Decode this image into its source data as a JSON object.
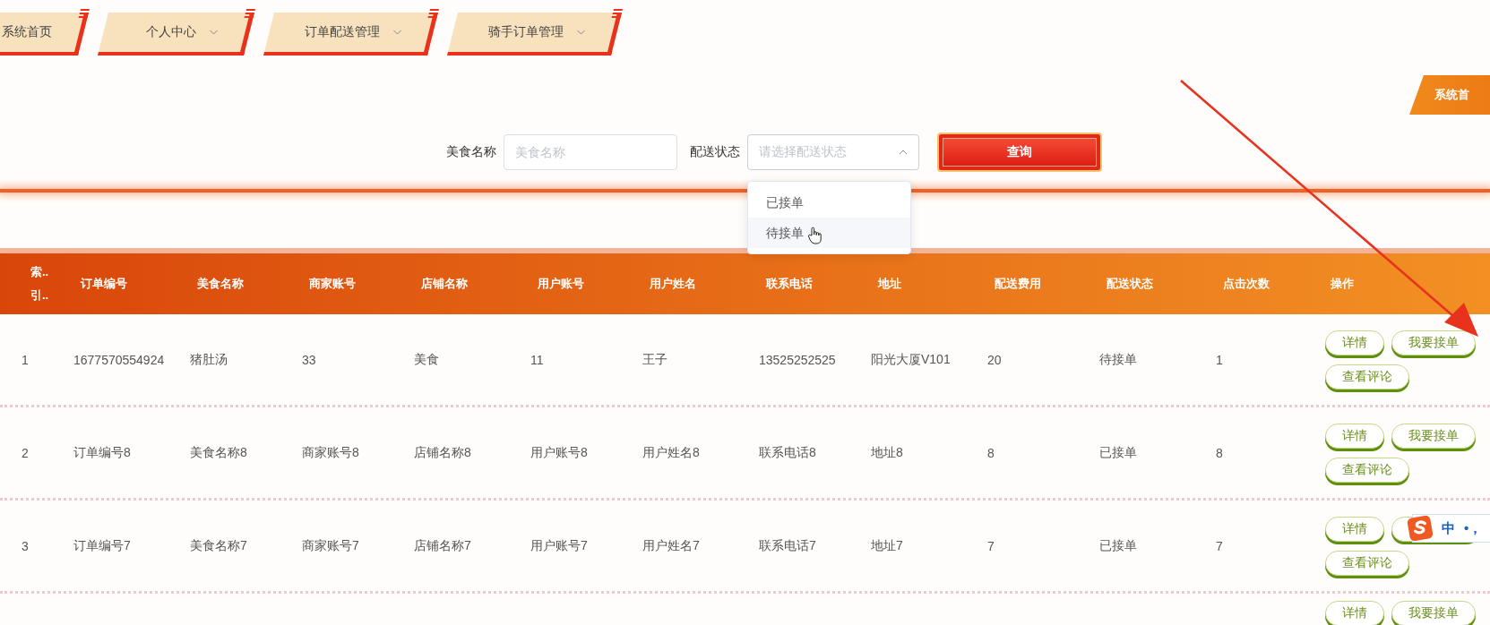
{
  "nav": {
    "tabs": [
      {
        "label": "系统首页",
        "has_menu": false
      },
      {
        "label": "个人中心",
        "has_menu": true
      },
      {
        "label": "订单配送管理",
        "has_menu": true
      },
      {
        "label": "骑手订单管理",
        "has_menu": true
      }
    ]
  },
  "corner_tab": {
    "label": "系统首"
  },
  "search": {
    "fields": [
      {
        "kind": "text",
        "label": "美食名称",
        "placeholder": "美食名称"
      },
      {
        "kind": "select",
        "label": "配送状态",
        "placeholder": "请选择配送状态",
        "expanded": true,
        "options": [
          {
            "label": "已接单",
            "hovered": false
          },
          {
            "label": "待接单",
            "hovered": true
          }
        ]
      }
    ],
    "button": "查询"
  },
  "table": {
    "columns": [
      "索..引..",
      "订单编号",
      "美食名称",
      "商家账号",
      "店铺名称",
      "用户账号",
      "用户姓名",
      "联系电话",
      "地址",
      "配送费用",
      "配送状态",
      "点击次数",
      "操作"
    ],
    "rows": [
      {
        "cells": [
          "1",
          "1677570554924",
          "猪肚汤",
          "33",
          "美食",
          "11",
          "王子",
          "13525252525",
          "阳光大厦V101",
          "20",
          "待接单",
          "1"
        ],
        "actions": [
          "详情",
          "我要接单",
          "查看评论"
        ]
      },
      {
        "cells": [
          "2",
          "订单编号8",
          "美食名称8",
          "商家账号8",
          "店铺名称8",
          "用户账号8",
          "用户姓名8",
          "联系电话8",
          "地址8",
          "8",
          "已接单",
          "8"
        ],
        "actions": [
          "详情",
          "我要接单",
          "查看评论"
        ]
      },
      {
        "cells": [
          "3",
          "订单编号7",
          "美食名称7",
          "商家账号7",
          "店铺名称7",
          "用户账号7",
          "用户姓名7",
          "联系电话7",
          "地址7",
          "7",
          "已接单",
          "7"
        ],
        "actions": [
          "详情",
          "查看评论"
        ],
        "covered_button": true
      },
      {
        "actions": [
          "详情",
          "我要接单"
        ]
      }
    ]
  },
  "ime_toolbar": {
    "mode": "中",
    "punctuation": "•，"
  },
  "annotation": {
    "kind": "arrow"
  }
}
